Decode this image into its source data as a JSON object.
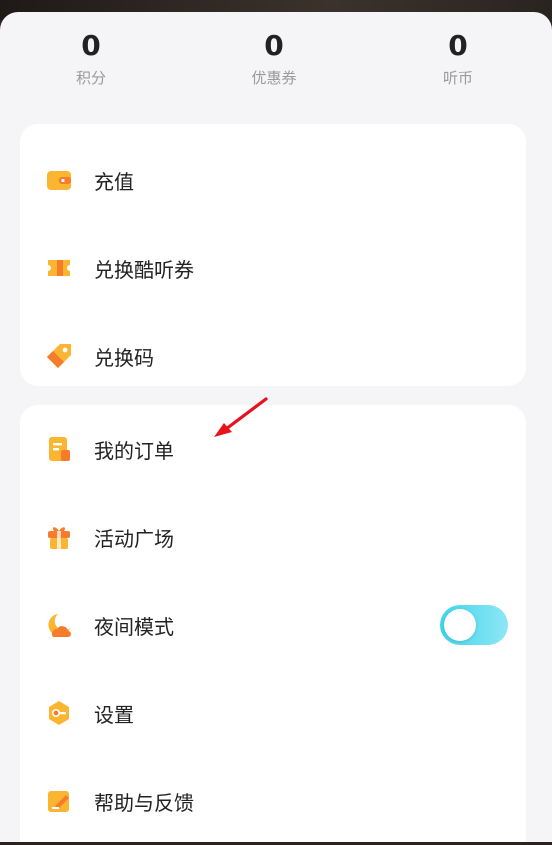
{
  "stats": [
    {
      "value": "0",
      "label": "积分"
    },
    {
      "value": "0",
      "label": "优惠券"
    },
    {
      "value": "0",
      "label": "听币"
    }
  ],
  "wallet_menu": {
    "items": [
      {
        "label": "充值",
        "icon": "wallet-icon"
      },
      {
        "label": "兑换酷听券",
        "icon": "ticket-icon"
      },
      {
        "label": "兑换码",
        "icon": "tag-icon"
      }
    ]
  },
  "main_menu": {
    "items": [
      {
        "label": "我的订单",
        "icon": "order-icon"
      },
      {
        "label": "活动广场",
        "icon": "gift-icon"
      },
      {
        "label": "夜间模式",
        "icon": "moon-icon"
      },
      {
        "label": "设置",
        "icon": "settings-icon"
      },
      {
        "label": "帮助与反馈",
        "icon": "edit-icon"
      }
    ]
  },
  "night_mode": {
    "enabled": false
  },
  "colors": {
    "accent": "#f9a825",
    "accent_dark": "#f57c2a",
    "toggle": "#3fd5ec",
    "annotation": "#e8121c"
  }
}
